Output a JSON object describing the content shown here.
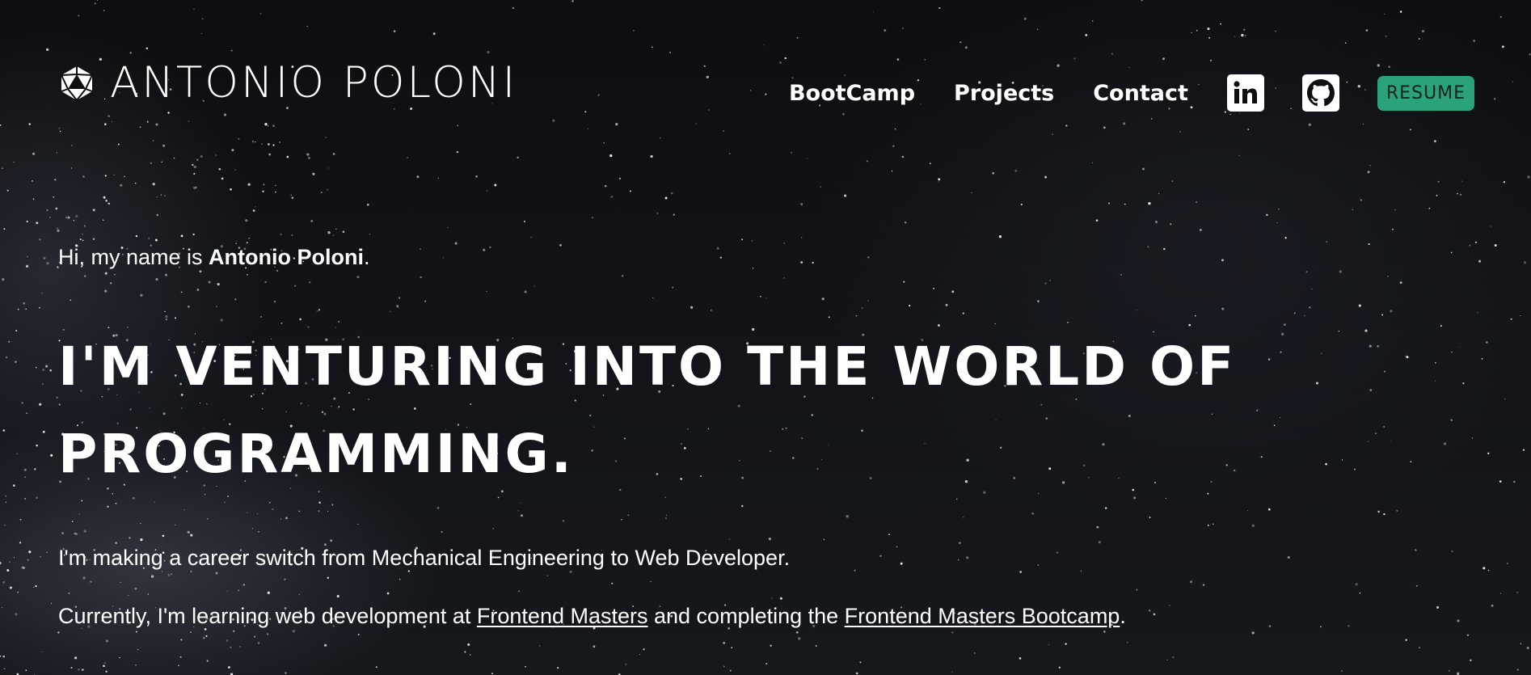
{
  "brand": {
    "name": "ANTONIO POLONI",
    "logo_icon": "d20-dice-icon"
  },
  "nav": {
    "links": [
      "BootCamp",
      "Projects",
      "Contact"
    ],
    "linkedin_icon": "linkedin-icon",
    "github_icon": "github-icon",
    "resume_label": "RESUME"
  },
  "hero": {
    "greeting_prefix": "Hi, my name is ",
    "greeting_name": "Antonio Poloni",
    "greeting_suffix": ".",
    "headline": "I'M VENTURING INTO THE WORLD OF PROGRAMMING.",
    "paragraph1": "I'm making a career switch from Mechanical Engineering to Web Developer.",
    "paragraph2_prefix": "Currently, I'm learning web development at ",
    "paragraph2_link1": "Frontend Masters",
    "paragraph2_middle": " and completing the ",
    "paragraph2_link2": "Frontend Masters Bootcamp",
    "paragraph2_suffix": "."
  },
  "colors": {
    "background": "#0e0f12",
    "resume_button": "#2aa37c",
    "text": "#ffffff"
  }
}
